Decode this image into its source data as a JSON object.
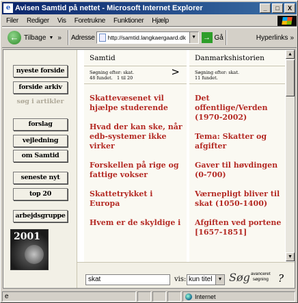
{
  "window": {
    "title": "Avisen Samtid på nettet - Microsoft Internet Explorer",
    "icon": "ie-icon",
    "controls": {
      "minimize": "_",
      "maximize": "□",
      "close": "X"
    }
  },
  "menu": [
    "Filer",
    "Rediger",
    "Vis",
    "Foretrukne",
    "Funktioner",
    "Hjælp"
  ],
  "toolbar": {
    "back_label": "Tilbage",
    "chevron": "»",
    "address_label": "Adresse",
    "address_url": "http://samtid.langkaergaard.dk",
    "go_label": "Gå",
    "links_label": "Hyperlinks",
    "back_arrow": "←",
    "go_arrow": "→"
  },
  "nav": {
    "items": [
      {
        "label": "nyeste forside"
      },
      {
        "label": "forside arkiv"
      },
      {
        "label": "forslag"
      },
      {
        "label": "vejledning"
      },
      {
        "label": "om Samtid"
      },
      {
        "label": "seneste nyt"
      },
      {
        "label": "top 20"
      },
      {
        "label": "arbejdsgruppe"
      }
    ],
    "search_articles_label": "søg i artikler",
    "logo_text": "2001"
  },
  "columns": [
    {
      "title": "Samtid",
      "info_line1": "Søgning efter: skat.",
      "info_line2": "48 fundet.   1 til 20",
      "next_arrow": ">",
      "articles": [
        "Skattevæsenet vil hjælpe studerende",
        "Hvad der kan ske, når edb-systemer ikke virker",
        "Forskellen på rige og fattige vokser",
        "Skattetrykket i Europa",
        "Hvem er de skyldige i"
      ]
    },
    {
      "title": "Danmarkshistorien",
      "info_line1": "Søgning efter: skat.",
      "info_line2": "11 fundet.",
      "articles": [
        "Det offentlige/Verden (1970-2002)",
        "Tema: Skatter og afgifter",
        "Gaver til høvdingen (0-700)",
        "Værnepligt bliver til skat (1050-1400)",
        "Afgiften ved portene [1657-1851]"
      ]
    }
  ],
  "search": {
    "query": "skat",
    "vis_label": "vis:",
    "select_value": "kun titel",
    "advanced_label_1": "avanceret",
    "advanced_label_2": "søgning",
    "help_label": "?",
    "logo_glyph": "Søg"
  },
  "status": {
    "zone_label": "Internet"
  },
  "colors": {
    "article_red": "#b42a24",
    "title_bar": "#0a246a"
  }
}
